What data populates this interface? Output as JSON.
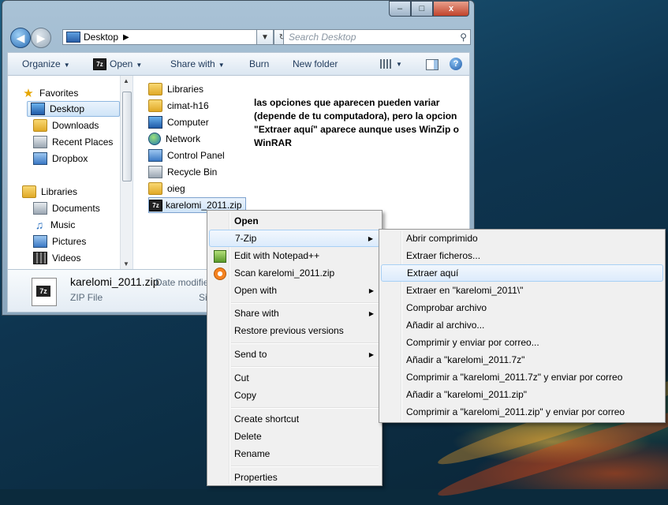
{
  "window": {
    "address_location": "Desktop",
    "search_placeholder": "Search Desktop",
    "caption_buttons": {
      "minimize": "–",
      "maximize": "□",
      "close": "x"
    }
  },
  "toolbar": {
    "organize": "Organize",
    "open": "Open",
    "share_with": "Share with",
    "burn": "Burn",
    "new_folder": "New folder",
    "help_icon": "?"
  },
  "nav_pane": {
    "favorites": "Favorites",
    "desktop": "Desktop",
    "downloads": "Downloads",
    "recent_places": "Recent Places",
    "dropbox": "Dropbox",
    "libraries": "Libraries",
    "documents": "Documents",
    "music": "Music",
    "pictures": "Pictures",
    "videos": "Videos"
  },
  "files": [
    {
      "name": "Libraries",
      "icon": "folder-icon"
    },
    {
      "name": "cimat-h16",
      "icon": "folder-icon"
    },
    {
      "name": "Computer",
      "icon": "computer-icon"
    },
    {
      "name": "Network",
      "icon": "network-icon"
    },
    {
      "name": "Control Panel",
      "icon": "control-panel-icon"
    },
    {
      "name": "Recycle Bin",
      "icon": "recycle-bin-icon"
    },
    {
      "name": "oieg",
      "icon": "folder-icon"
    },
    {
      "name": "karelomi_2011.zip",
      "icon": "7zip-icon",
      "selected": true
    }
  ],
  "annotation": "las opciones que aparecen pueden variar (depende de tu computadora), pero la opcion \"Extraer aquí\" aparece aunque uses WinZip o WinRAR",
  "details": {
    "name": "karelomi_2011.zip",
    "date_label": "Date modifie",
    "type": "ZIP File",
    "size_label": "Siz",
    "icon_text": "7z"
  },
  "context_menu": {
    "open": "Open",
    "seven_zip": "7-Zip",
    "edit_notepad": "Edit with Notepad++",
    "scan": "Scan karelomi_2011.zip",
    "open_with": "Open with",
    "share_with": "Share with",
    "restore": "Restore previous versions",
    "send_to": "Send to",
    "cut": "Cut",
    "copy": "Copy",
    "create_shortcut": "Create shortcut",
    "delete": "Delete",
    "rename": "Rename",
    "properties": "Properties"
  },
  "submenu": {
    "items": [
      "Abrir comprimido",
      "Extraer ficheros...",
      "Extraer aquí",
      "Extraer en \"karelomi_2011\\\"",
      "Comprobar archivo",
      "Añadir al archivo...",
      "Comprimir y enviar por correo...",
      "Añadir a \"karelomi_2011.7z\"",
      "Comprimir a \"karelomi_2011.7z\" y enviar por correo",
      "Añadir a \"karelomi_2011.zip\"",
      "Comprimir a \"karelomi_2011.zip\" y enviar por correo"
    ],
    "highlighted": "Extraer aquí"
  }
}
